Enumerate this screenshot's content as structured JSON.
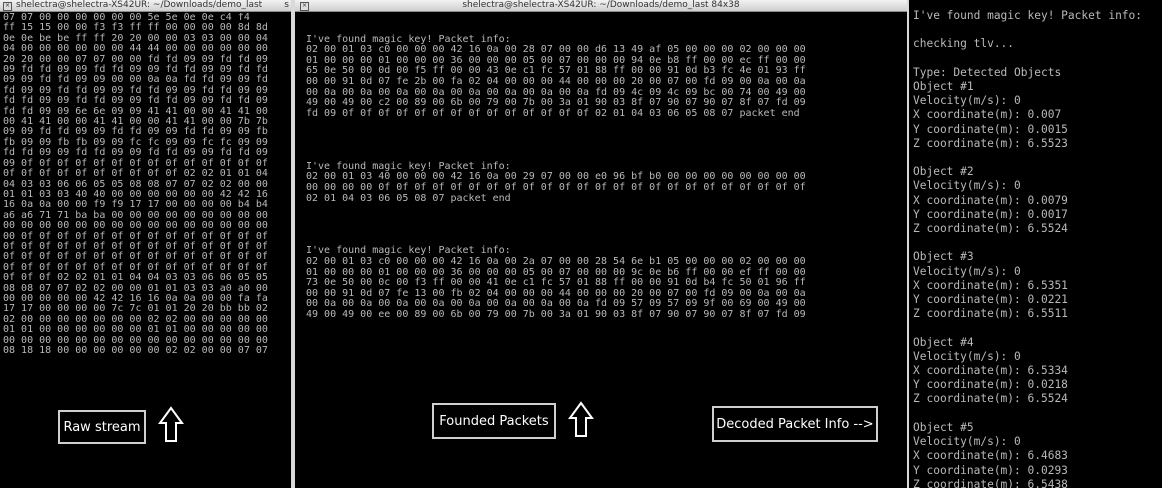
{
  "left_window": {
    "title": "shelectra@shelectra-XS42UR: ~/Downloads/demo_last",
    "title_suffix": "s",
    "hex_dump": "07 07 00 00 00 00 00 00 5e 5e 0e 0e c4 f4\nff 15 15 00 00 f3 f3 ff ff 00 00 00 00 8d 8d\n0e 0e be be ff ff 20 20 00 00 03 03 00 00 04\n04 00 00 00 00 00 00 44 44 00 00 00 00 00 00\n20 20 00 00 07 07 00 00 fd fd 09 09 fd fd 09\n09 fd fd 09 09 fd fd 09 09 fd fd 09 09 fd fd\n09 09 fd fd 09 09 00 00 0a 0a fd fd 09 09 fd\nfd 09 09 fd fd 09 09 fd fd 09 09 fd fd 09 09\nfd fd 09 09 fd fd 09 09 fd fd 09 09 fd fd 09\nfd fd 09 09 6e 6e 09 09 41 41 00 00 41 41 00\n00 41 41 00 00 41 41 00 00 41 41 00 00 7b 7b\n09 09 fd fd 09 09 fd fd 09 09 fd fd 09 09 fb\nfb 09 09 fb fb 09 09 fc fc 09 09 fc fc 09 09\nfd fd 09 09 fd fd 09 09 fd fd 09 09 fd fd 09\n09 0f 0f 0f 0f 0f 0f 0f 0f 0f 0f 0f 0f 0f 0f\n0f 0f 0f 0f 0f 0f 0f 0f 0f 0f 02 02 01 01 04\n04 03 03 06 06 05 05 08 08 07 07 02 02 00 00\n01 01 03 03 40 40 00 00 00 00 00 00 42 42 16\n16 0a 0a 00 00 f9 f9 17 17 00 00 00 00 b4 b4\na6 a6 71 71 ba ba 00 00 00 00 00 00 00 00 00\n00 00 00 00 00 00 00 00 00 00 00 00 00 00 00\n00 0f 0f 0f 0f 0f 0f 0f 0f 0f 0f 0f 0f 0f 0f\n0f 0f 0f 0f 0f 0f 0f 0f 0f 0f 0f 0f 0f 0f 0f\n0f 0f 0f 0f 0f 0f 0f 0f 0f 0f 0f 0f 0f 0f 0f\n0f 0f 0f 0f 0f 0f 0f 0f 0f 0f 0f 0f 0f 0f 0f\n0f 0f 0f 02 02 01 01 04 04 03 03 06 06 05 05\n08 08 07 07 02 02 00 00 01 01 03 03 a0 a0 00\n00 00 00 00 00 42 42 16 16 0a 0a 00 00 fa fa\n17 17 00 00 00 00 7c 7c 01 01 20 20 bb bb 02\n02 00 00 00 00 00 00 00 02 02 00 00 00 00 00\n01 01 00 00 00 00 00 00 01 01 00 00 00 00 00\n00 00 00 00 00 00 00 00 00 00 00 00 00 00 00\n08 18 18 00 00 00 00 00 00 02 02 00 00 07 07"
  },
  "middle_window": {
    "title": "shelectra@shelectra-XS42UR: ~/Downloads/demo_last 84x38",
    "packets_text": "\nI've found magic key! Packet info:\n02 00 01 03 c0 00 00 00 42 16 0a 00 28 07 00 00 d6 13 49 af 05 00 00 00 02 00 00 00\n01 00 00 00 01 00 00 00 36 00 00 00 05 00 07 00 00 00 94 0e b8 ff 00 00 ec ff 00 00\n65 0e 50 00 0d 00 f5 ff 00 00 43 0e c1 fc 57 01 88 ff 00 00 91 0d b3 fc 4e 01 93 ff\n00 00 91 0d 07 fe 2b 00 fa 02 04 00 00 00 44 00 00 00 20 00 07 00 fd 09 00 0a 00 0a\n00 0a 00 0a 00 0a 00 0a 00 0a 00 0a 00 0a 00 0a fd 09 4c 09 4c 09 bc 00 74 00 49 00\n49 00 49 00 c2 00 89 00 6b 00 79 00 7b 00 3a 01 90 03 8f 07 90 07 90 07 8f 07 fd 09\nfd 09 0f 0f 0f 0f 0f 0f 0f 0f 0f 0f 0f 0f 0f 0f 02 01 04 03 06 05 08 07 packet end\n\n\n\n\nI've found magic key! Packet info:\n02 00 01 03 40 00 00 00 42 16 0a 00 29 07 00 00 e0 96 bf b0 00 00 00 00 00 00 00 00\n00 00 00 00 0f 0f 0f 0f 0f 0f 0f 0f 0f 0f 0f 0f 0f 0f 0f 0f 0f 0f 0f 0f 0f 0f 0f 0f\n02 01 04 03 06 05 08 07 packet end\n\n\n\n\nI've found magic key! Packet info:\n02 00 01 03 c0 00 00 00 42 16 0a 00 2a 07 00 00 28 54 6e b1 05 00 00 00 02 00 00 00\n01 00 00 00 01 00 00 00 36 00 00 00 05 00 07 00 00 00 9c 0e b6 ff 00 00 ef ff 00 00\n73 0e 50 00 0c 00 f3 ff 00 00 41 0e c1 fc 57 01 88 ff 00 00 91 0d b4 fc 50 01 96 ff\n00 00 91 0d 07 fe 13 00 fb 02 04 00 00 00 44 00 00 00 20 00 07 00 fd 09 00 0a 00 0a\n00 0a 00 0a 00 0a 00 0a 00 0a 00 0a 00 0a 00 0a fd 09 57 09 57 09 9f 00 69 00 49 00\n49 00 49 00 ee 00 89 00 6b 00 79 00 7b 00 3a 01 90 03 8f 07 90 07 90 07 8f 07 fd 09"
  },
  "right_window": {
    "decoded_text": "I've found magic key! Packet info:\n\nchecking tlv...\n\nType: Detected Objects\nObject #1\nVelocity(m/s): 0\nX coordinate(m): 0.007\nY coordinate(m): 0.0015\nZ coordinate(m): 6.5523\n\nObject #2\nVelocity(m/s): 0\nX coordinate(m): 0.0079\nY coordinate(m): 0.0017\nZ coordinate(m): 6.5524\n\nObject #3\nVelocity(m/s): 0\nX coordinate(m): 6.5351\nY coordinate(m): 0.0221\nZ coordinate(m): 6.5511\n\nObject #4\nVelocity(m/s): 0\nX coordinate(m): 6.5334\nY coordinate(m): 0.0218\nZ coordinate(m): 6.5524\n\nObject #5\nVelocity(m/s): 0\nX coordinate(m): 6.4683\nY coordinate(m): 0.0293\nZ coordinate(m): 6.5438"
  },
  "labels": {
    "raw_stream": "Raw stream",
    "founded_packets": "Founded Packets",
    "decoded_packet_info": "Decoded Packet Info -->"
  },
  "colors": {
    "terminal_bg": "#000000",
    "terminal_text": "#b9b9b9",
    "label_border": "#cfcfcf",
    "divider": "#d9d9d9"
  },
  "icons": {
    "arrow": "up-arrow-icon",
    "window": "terminal-window-icon"
  }
}
